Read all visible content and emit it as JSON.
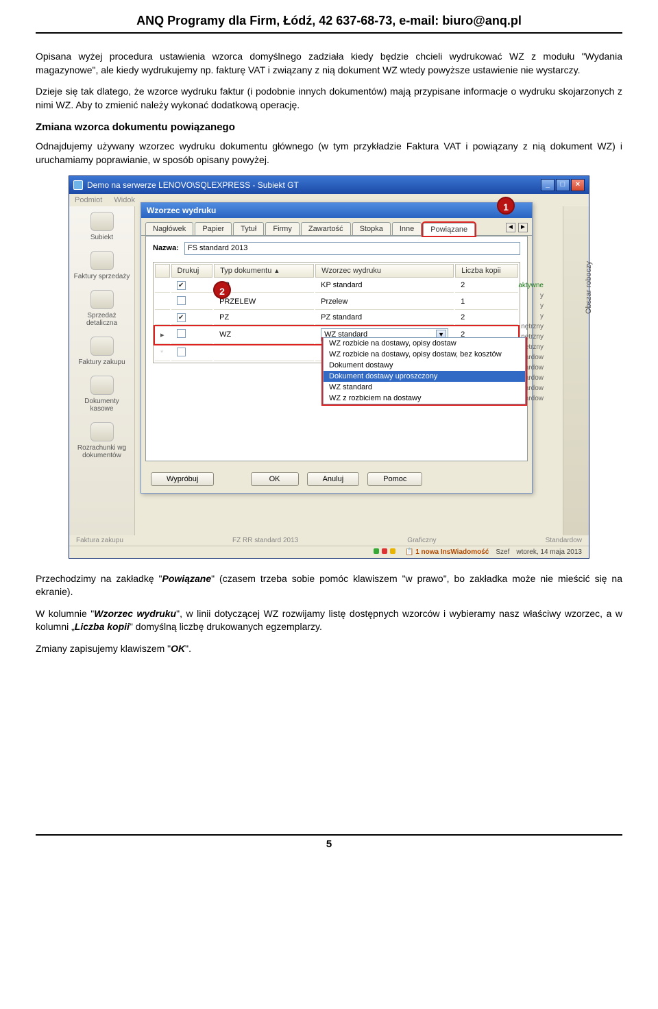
{
  "header": "ANQ Programy dla Firm, Łódź, 42 637-68-73, e-mail: biuro@anq.pl",
  "p1": "Opisana wyżej procedura ustawienia wzorca domyślnego zadziała kiedy będzie chcieli wydrukować WZ z modułu \"Wydania magazynowe\", ale kiedy wydrukujemy np. fakturę VAT i związany z nią dokument WZ wtedy powyższe ustawienie nie wystarczy.",
  "p2": "Dzieje się tak dlatego, że wzorce wydruku faktur (i podobnie innych dokumentów) mają przypisane informacje o wydruku skojarzonych z nimi WZ. Aby to zmienić należy wykonać dodatkową operację.",
  "h1": "Zmiana wzorca dokumentu powiązanego",
  "p3": "Odnajdujemy używany wzorzec wydruku dokumentu głównego (w tym przykładzie Faktura VAT i powiązany z nią dokument WZ) i uruchamiamy poprawianie, w sposób opisany powyżej.",
  "p4a": "Przechodzimy na zakładkę \"",
  "p4b": "Powiązane",
  "p4c": "\" (czasem trzeba sobie pomóc klawiszem \"w prawo\", bo zakładka może nie mieścić się na ekranie).",
  "p5a": "W kolumnie \"",
  "p5b": "Wzorzec wydruku",
  "p5c": "\", w linii dotyczącej WZ rozwijamy listę dostępnych wzorców i wybieramy nasz właściwy wzorzec, a w kolumni „",
  "p5d": "Liczba kopii",
  "p5e": "\" domyślną liczbę drukowanych egzemplarzy.",
  "p6a": "Zmiany zapisujemy klawiszem \"",
  "p6b": "OK",
  "p6c": "\".",
  "footer_page": "5",
  "app": {
    "title": "Demo na serwerze LENOVO\\SQLEXPRESS - Subiekt GT",
    "menu": [
      "Podmiot",
      "Widok"
    ],
    "nav": [
      "Subiekt",
      "Faktury sprzedaży",
      "Sprzedaż detaliczna",
      "Faktury zakupu",
      "Dokumenty kasowe",
      "Rozrachunki wg dokumentów"
    ],
    "dialog_title": "Wzorzec wydruku",
    "tabs": [
      "Nagłówek",
      "Papier",
      "Tytuł",
      "Firmy",
      "Zawartość",
      "Stopka",
      "Inne",
      "Powiązane"
    ],
    "name_label": "Nazwa:",
    "name_value": "FS standard 2013",
    "cols": [
      "Drukuj",
      "Typ dokumentu",
      "Wzorzec wydruku",
      "Liczba kopii"
    ],
    "rows": [
      {
        "ck": true,
        "t": "KP",
        "w": "KP standard",
        "k": "2"
      },
      {
        "ck": false,
        "t": "PRZELEW",
        "w": "Przelew",
        "k": "1"
      },
      {
        "ck": true,
        "t": "PZ",
        "w": "PZ standard",
        "k": "2"
      },
      {
        "ck": false,
        "t": "WZ",
        "w": "WZ standard",
        "k": "2"
      },
      {
        "ck": false,
        "t": "",
        "w": "",
        "k": ""
      }
    ],
    "dd": [
      "WZ rozbicie na dostawy, opisy dostaw",
      "WZ rozbicie na dostawy, opisy dostaw, bez kosztów",
      "Dokument dostawy",
      "Dokument dostawy uproszczony",
      "WZ standard",
      "WZ z rozbiciem na dostawy"
    ],
    "btns": {
      "try": "Wypróbuj",
      "ok": "OK",
      "cancel": "Anuluj",
      "help": "Pomoc"
    },
    "right_label": "Obszar roboczy",
    "peek": [
      "aktywne",
      "y",
      "y",
      "y",
      "nętrzny",
      "nętrzny",
      "nętrzny",
      "idardow",
      "idardow",
      "idardow",
      "idardow",
      "idardow"
    ],
    "status": {
      "info": "1 nowa InsWiadomość",
      "user": "Szef",
      "date": "wtorek, 14 maja 2013"
    },
    "bottom": {
      "left": "Faktura zakupu",
      "mid": "FZ RR standard 2013",
      "r1": "Graficzny",
      "r2": "Standardow"
    }
  }
}
